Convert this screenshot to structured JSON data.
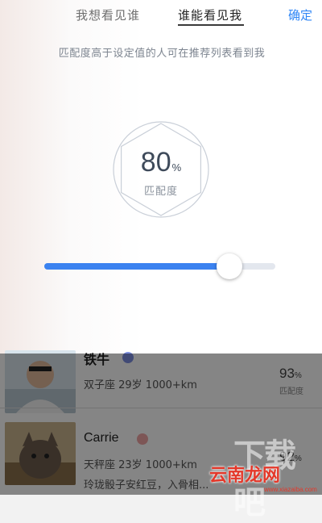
{
  "tabs": [
    {
      "label": "我想看见谁",
      "active": false
    },
    {
      "label": "谁能看见我",
      "active": true
    }
  ],
  "confirm_label": "确定",
  "description": "匹配度高于设定值的人可在推荐列表看到我",
  "gauge": {
    "value": "80",
    "unit": "%",
    "label": "匹配度"
  },
  "slider": {
    "value_percent": 80,
    "fill_color": "#3b82f0"
  },
  "accent_color": "#2f86f6",
  "list": [
    {
      "name": "铁牛",
      "badge_icon": "verified-badge-icon",
      "info": "双子座 29岁 1000+km",
      "score": "93",
      "score_unit": "%",
      "score_label": "匹配度"
    },
    {
      "name": "Carrie",
      "badge_icon": "female-badge-icon",
      "info": "天秤座 23岁 1000+km",
      "desc": "玲珑骰子安红豆，入骨相...",
      "score": "92",
      "score_unit": "%"
    }
  ],
  "watermark": {
    "big": "下载吧",
    "small": "云南龙网",
    "url": "www.xiazaiba.com"
  }
}
